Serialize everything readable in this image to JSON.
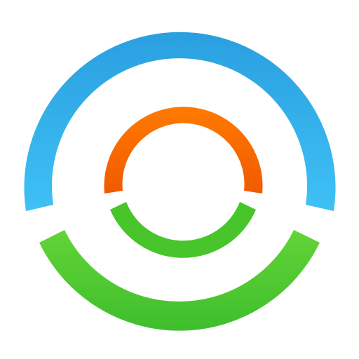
{
  "logo": {
    "icon_name": "concentric-ring-logo-icon",
    "colors": {
      "outer_top": "#2A9FE0",
      "outer_top_light": "#3EC1F5",
      "outer_bottom": "#3FBE2D",
      "outer_bottom_light": "#62D437",
      "inner_top": "#FF7A00",
      "inner_top_dark": "#F05A00",
      "inner_bottom": "#47C52A",
      "background": "#FFFFFF"
    }
  }
}
